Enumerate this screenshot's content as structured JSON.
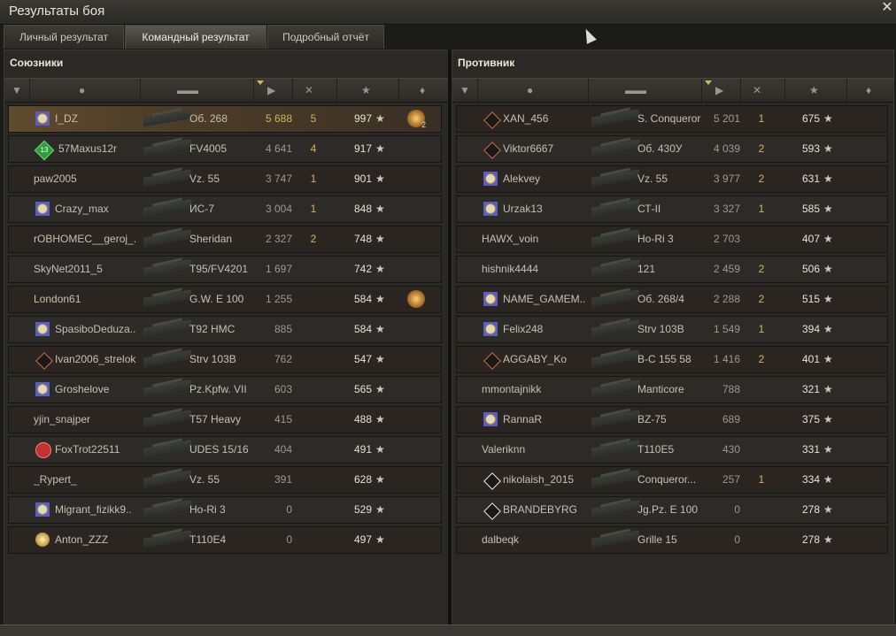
{
  "window": {
    "title": "Результаты боя"
  },
  "tabs": [
    {
      "label": "Личный результат"
    },
    {
      "label": "Командный результат"
    },
    {
      "label": "Подробный отчёт"
    }
  ],
  "allies": {
    "title": "Союзники",
    "rows": [
      {
        "badge": "medal",
        "name": "I_DZ",
        "vehicle": "Об. 268",
        "damage": "5 688",
        "kills": "5",
        "xp": "997",
        "medal": "2"
      },
      {
        "badge": "green",
        "badge_text": "13",
        "name": "57Maxus12r",
        "vehicle": "FV4005",
        "damage": "4 641",
        "kills": "4",
        "xp": "917"
      },
      {
        "badge": "",
        "name": "paw2005",
        "vehicle": "Vz. 55",
        "damage": "3 747",
        "kills": "1",
        "xp": "901"
      },
      {
        "badge": "medal",
        "name": "Crazy_max",
        "vehicle": "ИС-7",
        "damage": "3 004",
        "kills": "1",
        "xp": "848"
      },
      {
        "badge": "",
        "name": "rOBHOMEC__geroj_...",
        "vehicle": "Sheridan",
        "damage": "2 327",
        "kills": "2",
        "xp": "748"
      },
      {
        "badge": "",
        "name": "SkyNet2011_5",
        "vehicle": "T95/FV4201",
        "damage": "1 697",
        "kills": "",
        "xp": "742"
      },
      {
        "badge": "",
        "name": "London61",
        "vehicle": "G.W. E 100",
        "damage": "1 255",
        "kills": "",
        "xp": "584",
        "medal": ""
      },
      {
        "badge": "medal",
        "name": "SpasiboDeduza..",
        "vehicle": "T92 HMC",
        "damage": "885",
        "kills": "",
        "xp": "584"
      },
      {
        "badge": "diamond",
        "name": "Ivan2006_strelok",
        "vehicle": "Strv 103B",
        "damage": "762",
        "kills": "",
        "xp": "547"
      },
      {
        "badge": "medal",
        "name": "Groshelove",
        "vehicle": "Pz.Kpfw. VII",
        "damage": "603",
        "kills": "",
        "xp": "565"
      },
      {
        "badge": "",
        "name": "yjin_snajper",
        "vehicle": "T57 Heavy",
        "damage": "415",
        "kills": "",
        "xp": "488"
      },
      {
        "badge": "red",
        "name": "FoxTrot22511",
        "vehicle": "UDES 15/16",
        "damage": "404",
        "kills": "",
        "xp": "491"
      },
      {
        "badge": "",
        "name": "_Rypert_",
        "vehicle": "Vz. 55",
        "damage": "391",
        "kills": "",
        "xp": "628"
      },
      {
        "badge": "medal",
        "name": "Migrant_fizikk9..",
        "vehicle": "Ho-Ri 3",
        "damage": "0",
        "kills": "",
        "xp": "529"
      },
      {
        "badge": "gold",
        "name": "Anton_ZZZ",
        "vehicle": "T110E4",
        "damage": "0",
        "kills": "",
        "xp": "497"
      }
    ]
  },
  "enemies": {
    "title": "Противник",
    "rows": [
      {
        "badge": "diamond",
        "name": "XAN_456",
        "vehicle": "S. Conqueror",
        "damage": "5 201",
        "kills": "1",
        "xp": "675"
      },
      {
        "badge": "diamond",
        "name": "Viktor6667",
        "vehicle": "Об. 430У",
        "damage": "4 039",
        "kills": "2",
        "xp": "593"
      },
      {
        "badge": "medal",
        "name": "Alekvey",
        "vehicle": "Vz. 55",
        "damage": "3 977",
        "kills": "2",
        "xp": "631"
      },
      {
        "badge": "medal",
        "name": "Urzak13",
        "vehicle": "СТ-II",
        "damage": "3 327",
        "kills": "1",
        "xp": "585"
      },
      {
        "badge": "",
        "name": "HAWX_voin",
        "vehicle": "Ho-Ri 3",
        "damage": "2 703",
        "kills": "",
        "xp": "407"
      },
      {
        "badge": "",
        "name": "hishnik4444",
        "vehicle": "121",
        "damage": "2 459",
        "kills": "2",
        "xp": "506"
      },
      {
        "badge": "medal",
        "name": "NAME_GAMEM..",
        "vehicle": "Об. 268/4",
        "damage": "2 288",
        "kills": "2",
        "xp": "515"
      },
      {
        "badge": "medal",
        "name": "Felix248",
        "vehicle": "Strv 103B",
        "damage": "1 549",
        "kills": "1",
        "xp": "394"
      },
      {
        "badge": "diamond",
        "name": "AGGABY_Ko",
        "vehicle": "B-C 155 58",
        "damage": "1 416",
        "kills": "2",
        "xp": "401"
      },
      {
        "badge": "",
        "name": "mmontajnikk",
        "vehicle": "Manticore",
        "damage": "788",
        "kills": "",
        "xp": "321"
      },
      {
        "badge": "medal",
        "name": "RannaR",
        "vehicle": "BZ-75",
        "damage": "689",
        "kills": "",
        "xp": "375"
      },
      {
        "badge": "",
        "name": "Valeriknn",
        "vehicle": "T110E5",
        "damage": "430",
        "kills": "",
        "xp": "331"
      },
      {
        "badge": "diamondw",
        "name": "nikolaish_2015",
        "vehicle": "Conqueror...",
        "damage": "257",
        "kills": "1",
        "xp": "334"
      },
      {
        "badge": "diamondw",
        "name": "BRANDEBYRG",
        "vehicle": "Jg.Pz. E 100",
        "damage": "0",
        "kills": "",
        "xp": "278"
      },
      {
        "badge": "",
        "name": "dalbeqk",
        "vehicle": "Grille 15",
        "damage": "0",
        "kills": "",
        "xp": "278"
      }
    ]
  },
  "icons": {
    "star": "★",
    "close": "✕"
  }
}
